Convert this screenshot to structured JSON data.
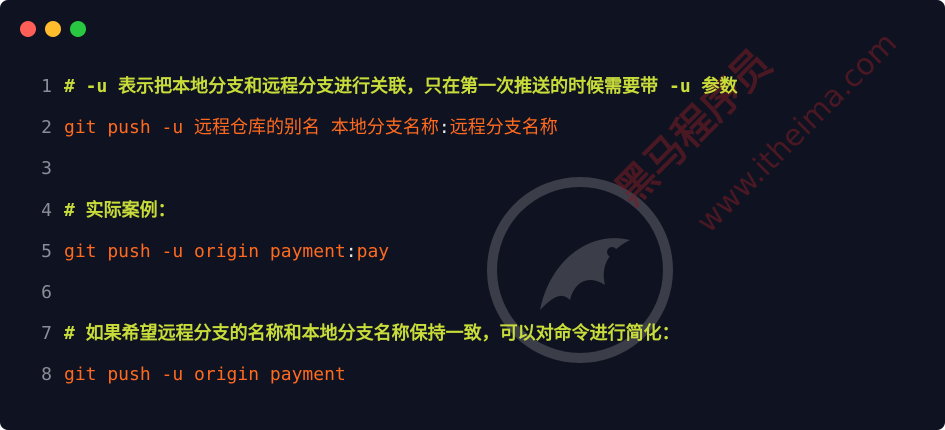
{
  "window": {
    "buttons": [
      "close",
      "minimize",
      "maximize"
    ]
  },
  "code_lines": [
    {
      "num": "1",
      "parts": [
        {
          "text": "# -u 表示把本地分支和远程分支进行关联，只在第一次推送的时候需要带 -u 参数",
          "style": "comment"
        }
      ]
    },
    {
      "num": "2",
      "parts": [
        {
          "text": "git push -u 远程仓库的别名 本地分支名称",
          "style": "kw"
        },
        {
          "text": ":",
          "style": "punct"
        },
        {
          "text": "远程分支名称",
          "style": "kw"
        }
      ]
    },
    {
      "num": "3",
      "parts": []
    },
    {
      "num": "4",
      "parts": [
        {
          "text": "# 实际案例：",
          "style": "comment"
        }
      ]
    },
    {
      "num": "5",
      "parts": [
        {
          "text": "git push -u origin payment",
          "style": "kw"
        },
        {
          "text": ":",
          "style": "punct"
        },
        {
          "text": "pay",
          "style": "kw"
        }
      ]
    },
    {
      "num": "6",
      "parts": []
    },
    {
      "num": "7",
      "parts": [
        {
          "text": "# 如果希望远程分支的名称和本地分支名称保持一致，可以对命令进行简化：",
          "style": "comment"
        }
      ]
    },
    {
      "num": "8",
      "parts": [
        {
          "text": "git push -u origin payment",
          "style": "kw"
        }
      ]
    }
  ],
  "watermark": {
    "brand_text": "黑马程序员",
    "url_text": "www.itheima.com"
  },
  "colors": {
    "background": "#0f1220",
    "comment": "#c8dc3a",
    "command": "#ff6a1f",
    "line_number": "#8b8d98"
  }
}
